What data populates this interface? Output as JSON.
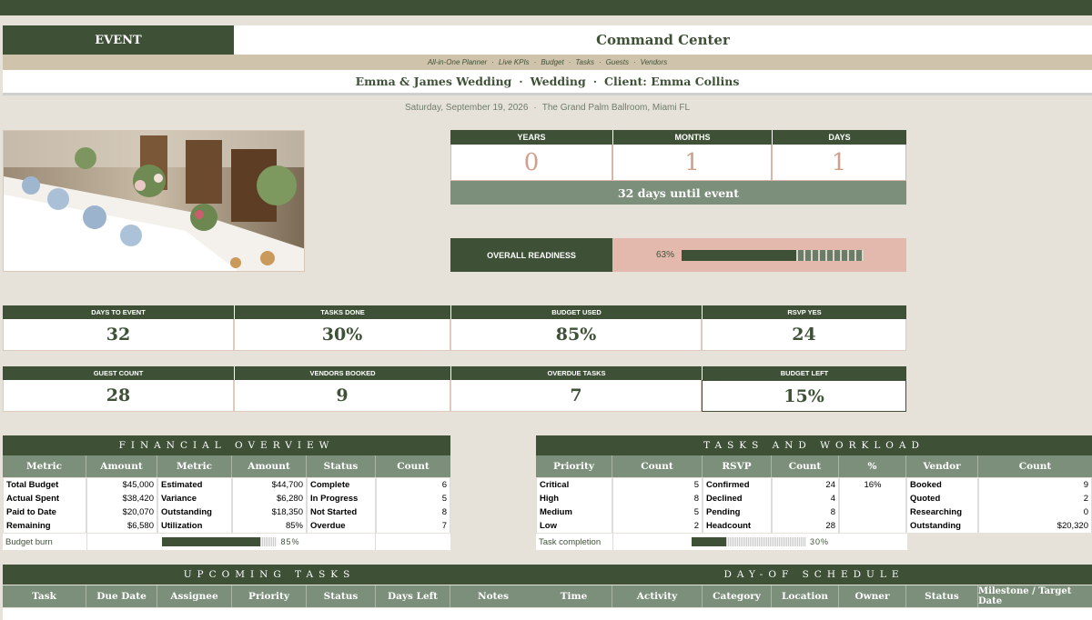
{
  "header": {
    "event_label": "EVENT",
    "title": "Command Center",
    "tagline": [
      "All-in-One Planner",
      "Live KPIs",
      "Budget",
      "Tasks",
      "Guests",
      "Vendors"
    ],
    "tagline_sep": "·",
    "event_name": "Emma & James Wedding",
    "event_type": "Wedding",
    "client": "Client: Emma Collins",
    "sep": "·",
    "date": "Saturday, September 19, 2026",
    "venue": "The Grand Palm Ballroom, Miami FL"
  },
  "countdown": {
    "labels": [
      "YEARS",
      "MONTHS",
      "DAYS"
    ],
    "values": [
      "0",
      "1",
      "1"
    ],
    "note": "32 days until event"
  },
  "readiness": {
    "label": "OVERALL READINESS",
    "percent_text": "63%",
    "fraction": 0.63
  },
  "kpis_row1": [
    {
      "label": "DAYS TO EVENT",
      "value": "32"
    },
    {
      "label": "TASKS DONE",
      "value": "30%"
    },
    {
      "label": "BUDGET USED",
      "value": "85%"
    },
    {
      "label": "RSVP YES",
      "value": "24"
    }
  ],
  "kpis_row2": [
    {
      "label": "GUEST COUNT",
      "value": "28"
    },
    {
      "label": "VENDORS BOOKED",
      "value": "9"
    },
    {
      "label": "OVERDUE TASKS",
      "value": "7"
    },
    {
      "label": "BUDGET LEFT",
      "value": "15%"
    }
  ],
  "financial": {
    "title": "FINANCIAL OVERVIEW",
    "headers": [
      "Metric",
      "Amount",
      "Metric",
      "Amount",
      "Status",
      "Count"
    ],
    "rows": [
      [
        "Total Budget",
        "$45,000",
        "Estimated",
        "$44,700",
        "Complete",
        "6"
      ],
      [
        "Actual Spent",
        "$38,420",
        "Variance",
        "$6,280",
        "In Progress",
        "5"
      ],
      [
        "Paid to Date",
        "$20,070",
        "Outstanding",
        "$18,350",
        "Not Started",
        "8"
      ],
      [
        "Remaining",
        "$6,580",
        "Utilization",
        "85%",
        "Overdue",
        "7"
      ]
    ],
    "burn_label": "Budget burn",
    "burn_text": "85%",
    "burn_fraction": 0.85
  },
  "tasks": {
    "title": "TASKS AND WORKLOAD",
    "headers": [
      "Priority",
      "Count",
      "RSVP",
      "Count",
      "%",
      "Vendor",
      "Count"
    ],
    "rows": [
      [
        "Critical",
        "5",
        "Confirmed",
        "24",
        "16%",
        "Booked",
        "9"
      ],
      [
        "High",
        "8",
        "Declined",
        "4",
        "",
        "Quoted",
        "2"
      ],
      [
        "Medium",
        "5",
        "Pending",
        "8",
        "",
        "Researching",
        "0"
      ],
      [
        "Low",
        "2",
        "Headcount",
        "28",
        "",
        "Outstanding",
        "$20,320"
      ]
    ],
    "completion_label": "Task completion",
    "completion_text": "30%",
    "completion_fraction": 0.3
  },
  "upcoming": {
    "title": "UPCOMING TASKS",
    "headers": [
      "Task",
      "Due Date",
      "Assignee",
      "Priority",
      "Status",
      "Days Left",
      "Notes"
    ]
  },
  "schedule": {
    "title": "DAY-OF SCHEDULE",
    "headers": [
      "Time",
      "Activity",
      "Category",
      "Location",
      "Owner",
      "Status",
      "Milestone / Target Date"
    ]
  }
}
